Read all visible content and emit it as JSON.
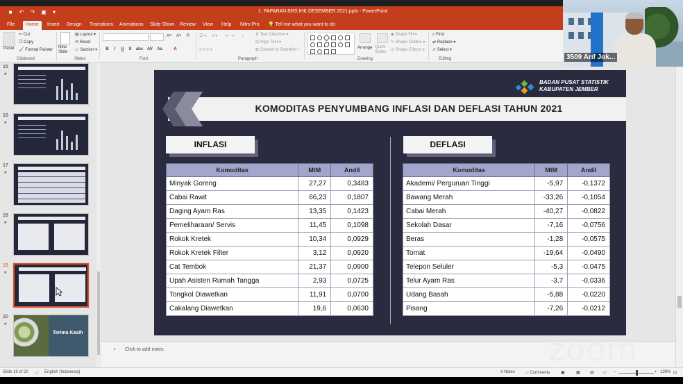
{
  "window": {
    "title": "1. PAPARAN BRS IHK DESEMBER 2021.pptx - PowerPoint",
    "tell_me": "Tell me what you want to do"
  },
  "tabs": [
    "File",
    "Home",
    "Insert",
    "Design",
    "Transitions",
    "Animations",
    "Slide Show",
    "Review",
    "View",
    "Help",
    "Nitro Pro"
  ],
  "ribbon": {
    "clipboard": {
      "paste": "Paste",
      "cut": "Cut",
      "copy": "Copy",
      "format_painter": "Format Painter",
      "label": "Clipboard"
    },
    "slides": {
      "new_slide": "New Slide",
      "layout": "Layout",
      "reset": "Reset",
      "section": "Section",
      "label": "Slides"
    },
    "font": {
      "label": "Font",
      "bold": "B",
      "italic": "I",
      "underline": "U",
      "strike": "S",
      "shadow": "abc",
      "spacing": "AV",
      "case": "Aa",
      "color": "A"
    },
    "paragraph": {
      "label": "Paragraph",
      "text_direction": "Text Direction",
      "align_text": "Align Text",
      "smartart": "Convert to SmartArt"
    },
    "drawing": {
      "label": "Drawing",
      "arrange": "Arrange",
      "quick_styles": "Quick Styles",
      "shape_fill": "Shape Fill",
      "shape_outline": "Shape Outline",
      "shape_effects": "Shape Effects"
    },
    "editing": {
      "label": "Editing",
      "find": "Find",
      "replace": "Replace",
      "select": "Select"
    }
  },
  "thumbnails": [
    {
      "num": "15",
      "star": "★"
    },
    {
      "num": "16",
      "star": "★"
    },
    {
      "num": "17",
      "star": "★"
    },
    {
      "num": "18",
      "star": "★"
    },
    {
      "num": "19",
      "star": "★"
    },
    {
      "num": "20",
      "star": "★",
      "title": "Terima Kasih"
    }
  ],
  "slide": {
    "org_line1": "BADAN PUSAT STATISTIK",
    "org_line2": "KABUPATEN JEMBER",
    "title": "KOMODITAS PENYUMBANG INFLASI DAN DEFLASI TAHUN 2021",
    "inflasi": {
      "label": "INFLASI",
      "headers": [
        "Komoditas",
        "MtM",
        "Andil"
      ],
      "rows": [
        [
          "Minyak Goreng",
          "27,27",
          "0,3483"
        ],
        [
          "Cabai Rawit",
          "66,23",
          "0,1807"
        ],
        [
          "Daging Ayam Ras",
          "13,35",
          "0,1423"
        ],
        [
          "Pemeliharaan/ Servis",
          "11,45",
          "0,1098"
        ],
        [
          "Rokok Kretek",
          "10,34",
          "0,0929"
        ],
        [
          "Rokok Kretek Filter",
          "3,12",
          "0,0920"
        ],
        [
          "Cat Tembok",
          "21,37",
          "0,0900"
        ],
        [
          "Upah Asisten Rumah Tangga",
          "2,93",
          "0,0725"
        ],
        [
          "Tongkol Diawetkan",
          "11,91",
          "0,0700"
        ],
        [
          "Cakalang Diawetkan",
          "19,6",
          "0,0630"
        ]
      ]
    },
    "deflasi": {
      "label": "DEFLASI",
      "headers": [
        "Komoditas",
        "MtM",
        "Andil"
      ],
      "rows": [
        [
          "Akademi/ Perguruan Tinggi",
          "-5,97",
          "-0,1372"
        ],
        [
          "Bawang Merah",
          "-33,26",
          "-0,1054"
        ],
        [
          "Cabai Merah",
          "-40,27",
          "-0,0822"
        ],
        [
          "Sekolah Dasar",
          "-7,16",
          "-0,0756"
        ],
        [
          "Beras",
          "-1,28",
          "-0,0575"
        ],
        [
          "Tomat",
          "-19,64",
          "-0,0490"
        ],
        [
          "Telepon Seluler",
          "-5,3",
          "-0,0475"
        ],
        [
          "Telur Ayam Ras",
          "-3,7",
          "-0,0336"
        ],
        [
          "Udang Basah",
          "-5,88",
          "-0,0220"
        ],
        [
          "Pisang",
          "-7,26",
          "-0,0212"
        ]
      ]
    }
  },
  "notes": {
    "placeholder": "Click to add notes"
  },
  "status": {
    "slide_of": "Slide 19 of 20",
    "language": "English (Indonesia)",
    "notes_btn": "Notes",
    "comments_btn": "Comments",
    "zoom_level": "139%"
  },
  "video": {
    "participant": "3509 Arif Jok..."
  },
  "watermark": "zoom"
}
